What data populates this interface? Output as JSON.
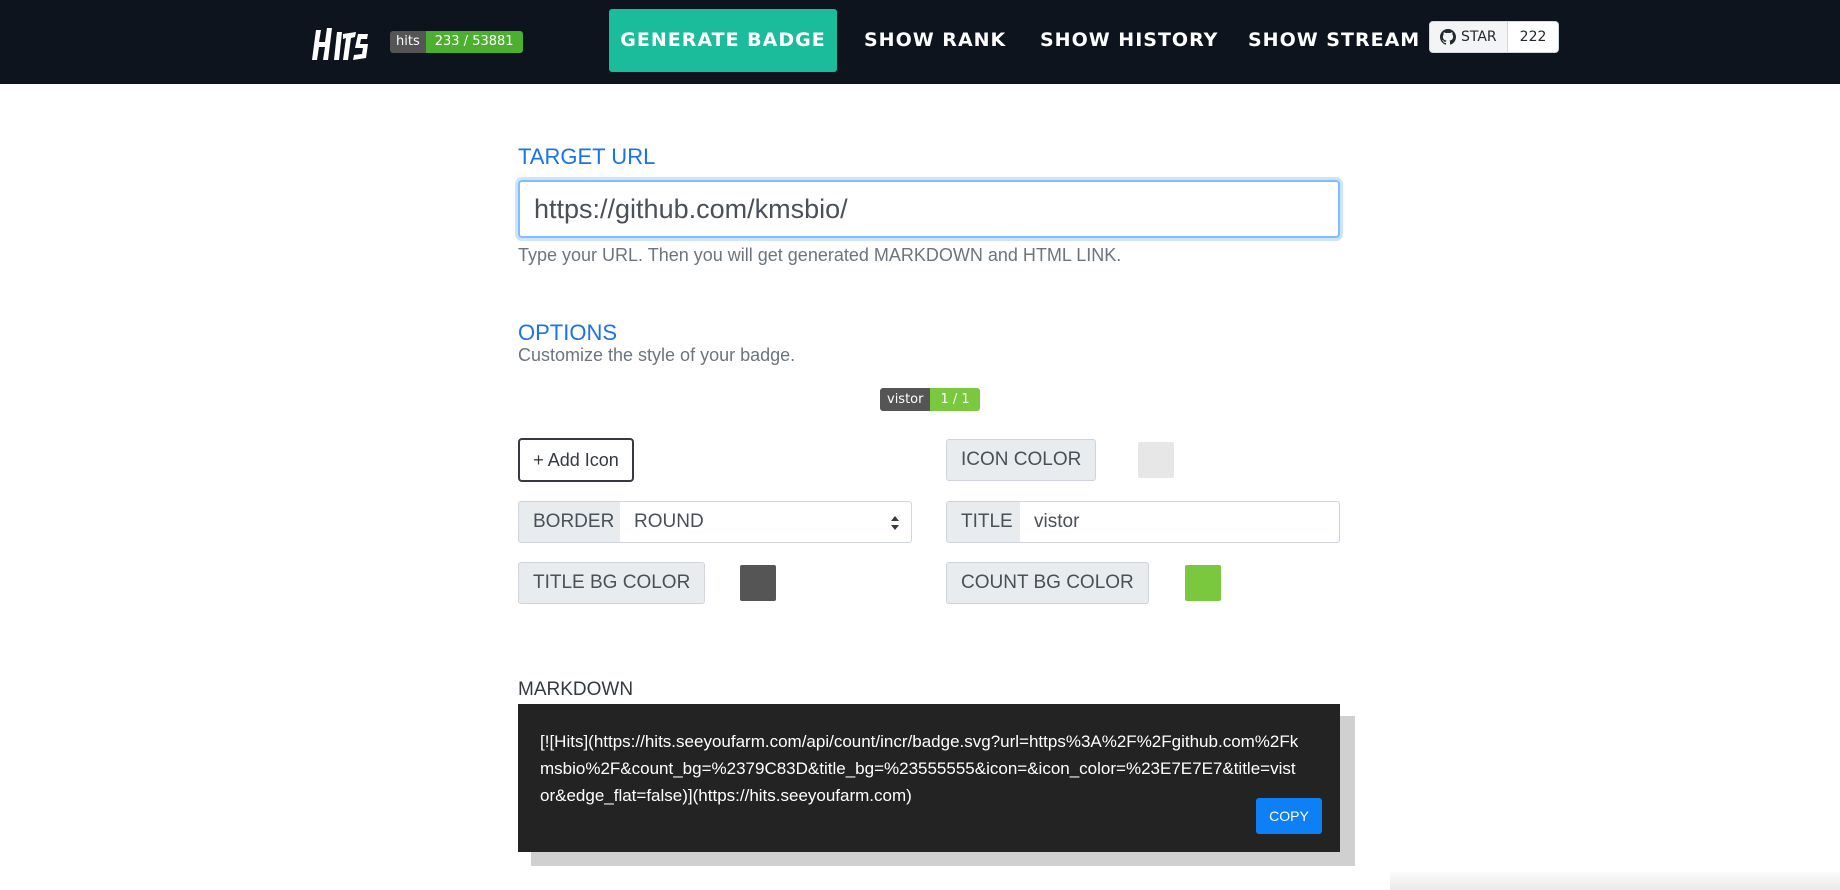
{
  "nav": {
    "hits_label": "hits",
    "hits_count": "233 / 53881",
    "generate": "GENERATE BADGE",
    "rank": "SHOW RANK",
    "history": "SHOW HISTORY",
    "stream": "SHOW STREAM",
    "star_label": "STAR",
    "star_count": "222"
  },
  "target": {
    "label": "TARGET URL",
    "value": "https://github.com/kmsbio/",
    "help": "Type your URL. Then you will get generated MARKDOWN and HTML LINK."
  },
  "options": {
    "label": "OPTIONS",
    "help": "Customize the style of your badge.",
    "preview_title": "vistor",
    "preview_count": "1 / 1",
    "add_icon": "+ Add Icon",
    "icon_color_label": "ICON COLOR",
    "icon_color": "#E7E7E7",
    "border_label": "BORDER",
    "border_value": "ROUND",
    "title_label": "TITLE",
    "title_value": "vistor",
    "title_bg_label": "TITLE BG COLOR",
    "title_bg_color": "#555555",
    "count_bg_label": "COUNT BG COLOR",
    "count_bg_color": "#79C83D"
  },
  "markdown": {
    "label": "MARKDOWN",
    "code": "[![Hits](https://hits.seeyoufarm.com/api/count/incr/badge.svg?url=https%3A%2F%2Fgithub.com%2Fkmsbio%2F&count_bg=%2379C83D&title_bg=%23555555&icon=&icon_color=%23E7E7E7&title=vistor&edge_flat=false)](https://hits.seeyoufarm.com)",
    "copy": "COPY"
  },
  "colors": {
    "navbar": "#0e141d",
    "accent": "#1abc9c",
    "link_blue": "#1a73e8",
    "copy_blue": "#0d7ff7"
  }
}
